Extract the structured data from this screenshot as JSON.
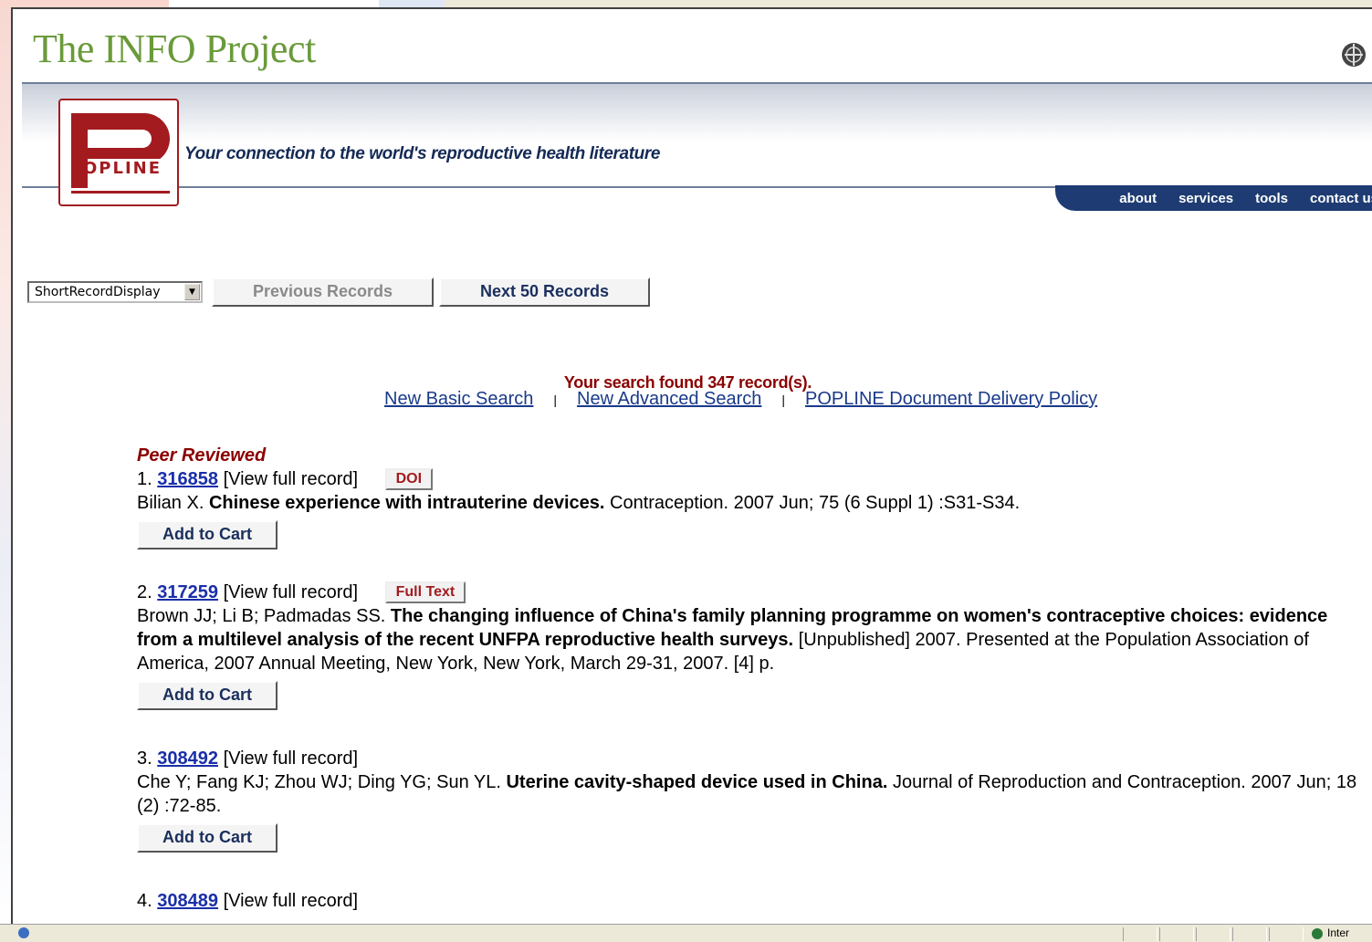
{
  "site": {
    "title": "The INFO Project"
  },
  "popline": {
    "logo_text": "OPLINE",
    "tagline": "Your connection to the world's reproductive health literature"
  },
  "nav": {
    "items": [
      "about",
      "services",
      "tools",
      "contact us"
    ]
  },
  "controls": {
    "display_select": "ShortRecordDisplay",
    "prev_label": "Previous Records",
    "next_label": "Next 50 Records"
  },
  "search": {
    "found_text": "Your search found 347 record(s).",
    "links": [
      "New Basic Search",
      "New Advanced Search",
      "POPLINE Document Delivery Policy"
    ]
  },
  "results": {
    "section_label": "Peer Reviewed",
    "add_to_cart_label": "Add to Cart",
    "records": [
      {
        "num": "1.",
        "id": "316858",
        "view_label": "[View full record]",
        "badge": "DOI",
        "authors": "Bilian X.",
        "title": "Chinese experience with intrauterine devices.",
        "citation": "Contraception. 2007 Jun; 75 (6 Suppl 1) :S31-S34."
      },
      {
        "num": "2.",
        "id": "317259",
        "view_label": "[View full record]",
        "badge": "Full Text",
        "authors": "Brown JJ; Li B; Padmadas SS.",
        "title": "The changing influence of China's family planning programme on women's contraceptive choices: evidence from a multilevel analysis of the recent UNFPA reproductive health surveys.",
        "citation": "[Unpublished] 2007. Presented at the Population Association of America, 2007 Annual Meeting, New York, New York, March 29-31, 2007. [4] p."
      },
      {
        "num": "3.",
        "id": "308492",
        "view_label": "[View full record]",
        "badge": "",
        "authors": "Che Y; Fang KJ; Zhou WJ; Ding YG; Sun YL.",
        "title": "Uterine cavity-shaped device used in China.",
        "citation": "Journal of Reproduction and Contraception. 2007 Jun; 18 (2) :72-85."
      },
      {
        "num": "4.",
        "id": "308489",
        "view_label": "[View full record]",
        "badge": "",
        "authors": "",
        "title": "",
        "citation": ""
      }
    ]
  },
  "statusbar": {
    "zone_text": "Inter"
  },
  "colors": {
    "brand_green": "#6a9a3a",
    "popline_red": "#a31b1f",
    "nav_blue": "#1e3c73",
    "found_red": "#8b0000"
  }
}
